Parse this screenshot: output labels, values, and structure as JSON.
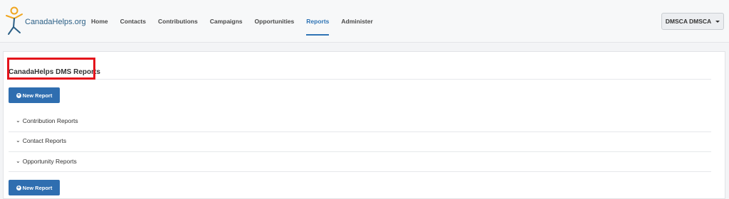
{
  "brand": {
    "logo_text": "CanadaHelps.org"
  },
  "nav": {
    "items": [
      {
        "label": "Home"
      },
      {
        "label": "Contacts"
      },
      {
        "label": "Contributions"
      },
      {
        "label": "Campaigns"
      },
      {
        "label": "Opportunities"
      },
      {
        "label": "Reports"
      },
      {
        "label": "Administer"
      }
    ],
    "active": "Reports"
  },
  "user": {
    "name": "DMSCA DMSCA"
  },
  "page": {
    "title": "CanadaHelps DMS Reports",
    "new_report_label": "New Report",
    "sections": [
      {
        "label": "Contribution Reports"
      },
      {
        "label": "Contact Reports"
      },
      {
        "label": "Opportunity Reports"
      }
    ]
  },
  "colors": {
    "accent": "#2f74b5",
    "button": "#2f6eb0",
    "highlight": "#e4131b"
  },
  "icons": {
    "logo": "canadahelps-figure-icon",
    "plus": "plus-circle-icon",
    "chevron": "chevron-down-icon",
    "caret": "caret-down-icon"
  }
}
